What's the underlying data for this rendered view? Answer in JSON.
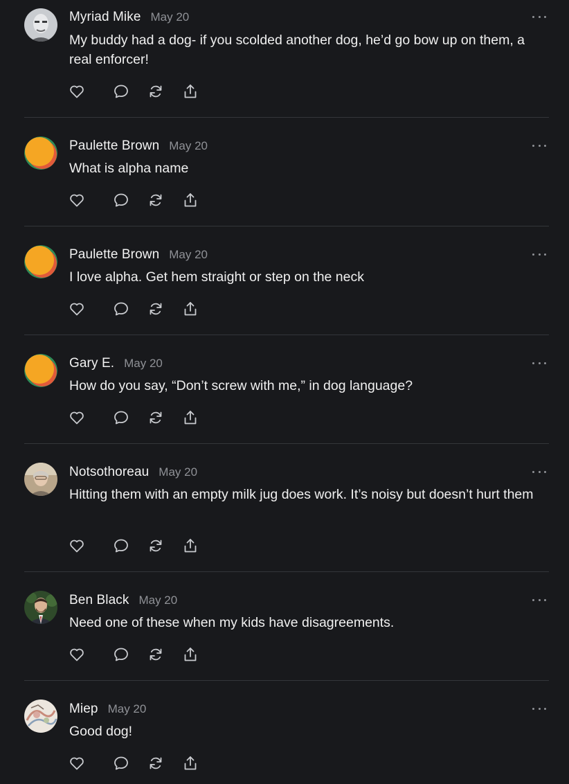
{
  "comments": [
    {
      "author": "Myriad Mike",
      "date": "May 20",
      "text": "My buddy had a dog- if you scolded another dog, he’d go bow up on them, a real enforcer!",
      "avatar": "photo-man"
    },
    {
      "author": "Paulette Brown",
      "date": "May 20",
      "text": "What is alpha name",
      "avatar": "default-orange"
    },
    {
      "author": "Paulette Brown",
      "date": "May 20",
      "text": "I love alpha. Get hem straight or step on the neck",
      "avatar": "default-orange"
    },
    {
      "author": "Gary E.",
      "date": "May 20",
      "text": "How do you say, “Don’t screw with me,” in dog language?",
      "avatar": "default-orange"
    },
    {
      "author": "Notsothoreau",
      "date": "May 20",
      "text": "Hitting them with an empty milk jug does work. It’s noisy but doesn’t hurt them",
      "avatar": "photo-woman"
    },
    {
      "author": "Ben Black",
      "date": "May 20",
      "text": "Need one of these when my kids have disagreements.",
      "avatar": "photo-man-suit"
    },
    {
      "author": "Miep",
      "date": "May 20",
      "text": "Good dog!",
      "avatar": "photo-artwork"
    }
  ],
  "icons": {
    "like": "heart-icon",
    "reply": "comment-icon",
    "restack": "restack-icon",
    "share": "share-icon",
    "more": "more-icon"
  },
  "colors": {
    "background": "#18191c",
    "text": "#f0f0f0",
    "muted": "#8f9196",
    "divider": "#34363a",
    "avatar_orange": "#f5a623",
    "avatar_green": "#2e8b57",
    "avatar_red": "#e05a3a"
  }
}
